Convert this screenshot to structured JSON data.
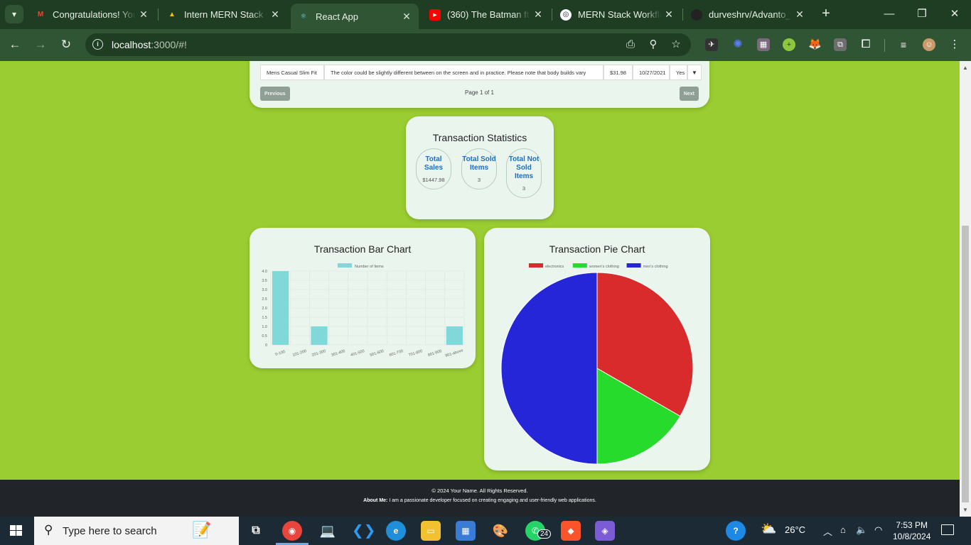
{
  "browser": {
    "tabs": [
      {
        "title": "Congratulations! You",
        "favicon": "gmail-icon",
        "color": "#ea4335"
      },
      {
        "title": "Intern MERN Stack Co",
        "favicon": "drive-icon",
        "color": "#fbbc04"
      },
      {
        "title": "React App",
        "favicon": "react-icon",
        "color": "#61dafb"
      },
      {
        "title": "(360) The Batman ft. I",
        "favicon": "youtube-icon",
        "color": "#ff0000"
      },
      {
        "title": "MERN Stack Workflo",
        "favicon": "chatgpt-icon",
        "color": "#ffffff"
      },
      {
        "title": "durveshrv/Advanto_T",
        "favicon": "github-icon",
        "color": "#222222"
      }
    ],
    "active_tab_index": 2,
    "url_host": "localhost",
    "url_rest": ":3000/#!"
  },
  "table": {
    "row": {
      "title": "Mens Casual Slim Fit",
      "description": "The color could be slightly different between on the screen and in practice. Please note that body builds vary",
      "price": "$31.98",
      "date": "10/27/2021",
      "sold": "Yes"
    },
    "previous_label": "Previous",
    "next_label": "Next",
    "page_info": "Page 1 of 1"
  },
  "stats": {
    "title": "Transaction Statistics",
    "total_sales_label": "Total Sales",
    "total_sales_value": "$1447.98",
    "sold_label": "Total Sold Items",
    "sold_value": "3",
    "not_sold_label": "Total Not Sold Items",
    "not_sold_value": "3"
  },
  "bar_chart": {
    "title": "Transaction Bar Chart"
  },
  "pie_chart": {
    "title": "Transaction Pie Chart"
  },
  "chart_data": [
    {
      "type": "bar",
      "title": "Transaction Bar Chart",
      "categories": [
        "0-100",
        "101-200",
        "201-300",
        "301-400",
        "401-500",
        "501-600",
        "601-700",
        "701-800",
        "801-900",
        "901-above"
      ],
      "series": [
        {
          "name": "Number of Items",
          "values": [
            4,
            0,
            1,
            0,
            0,
            0,
            0,
            0,
            0,
            1
          ],
          "color": "#80d8d8"
        }
      ],
      "yticks": [
        "0",
        "0.5",
        "1.0",
        "1.5",
        "2.0",
        "2.5",
        "3.0",
        "3.5",
        "4.0"
      ],
      "ylim": [
        0,
        4
      ],
      "grid": true,
      "legend": "top"
    },
    {
      "type": "pie",
      "title": "Transaction Pie Chart",
      "labels": [
        "electronics",
        "women's clothing",
        "men's clothing"
      ],
      "values": [
        2,
        1,
        3
      ],
      "colors": [
        "#d92b2b",
        "#26db2b",
        "#2626d9"
      ],
      "legend": "top"
    }
  ],
  "footer": {
    "copyright": "© 2024 Your Name. All Rights Reserved.",
    "about_label": "About Me:",
    "about_text": " I am a passionate developer focused on creating engaging and user-friendly web applications."
  },
  "taskbar": {
    "search_placeholder": "Type here to search",
    "whatsapp_badge": "24",
    "weather": "26°C",
    "time": "7:53 PM",
    "date": "10/8/2024"
  }
}
